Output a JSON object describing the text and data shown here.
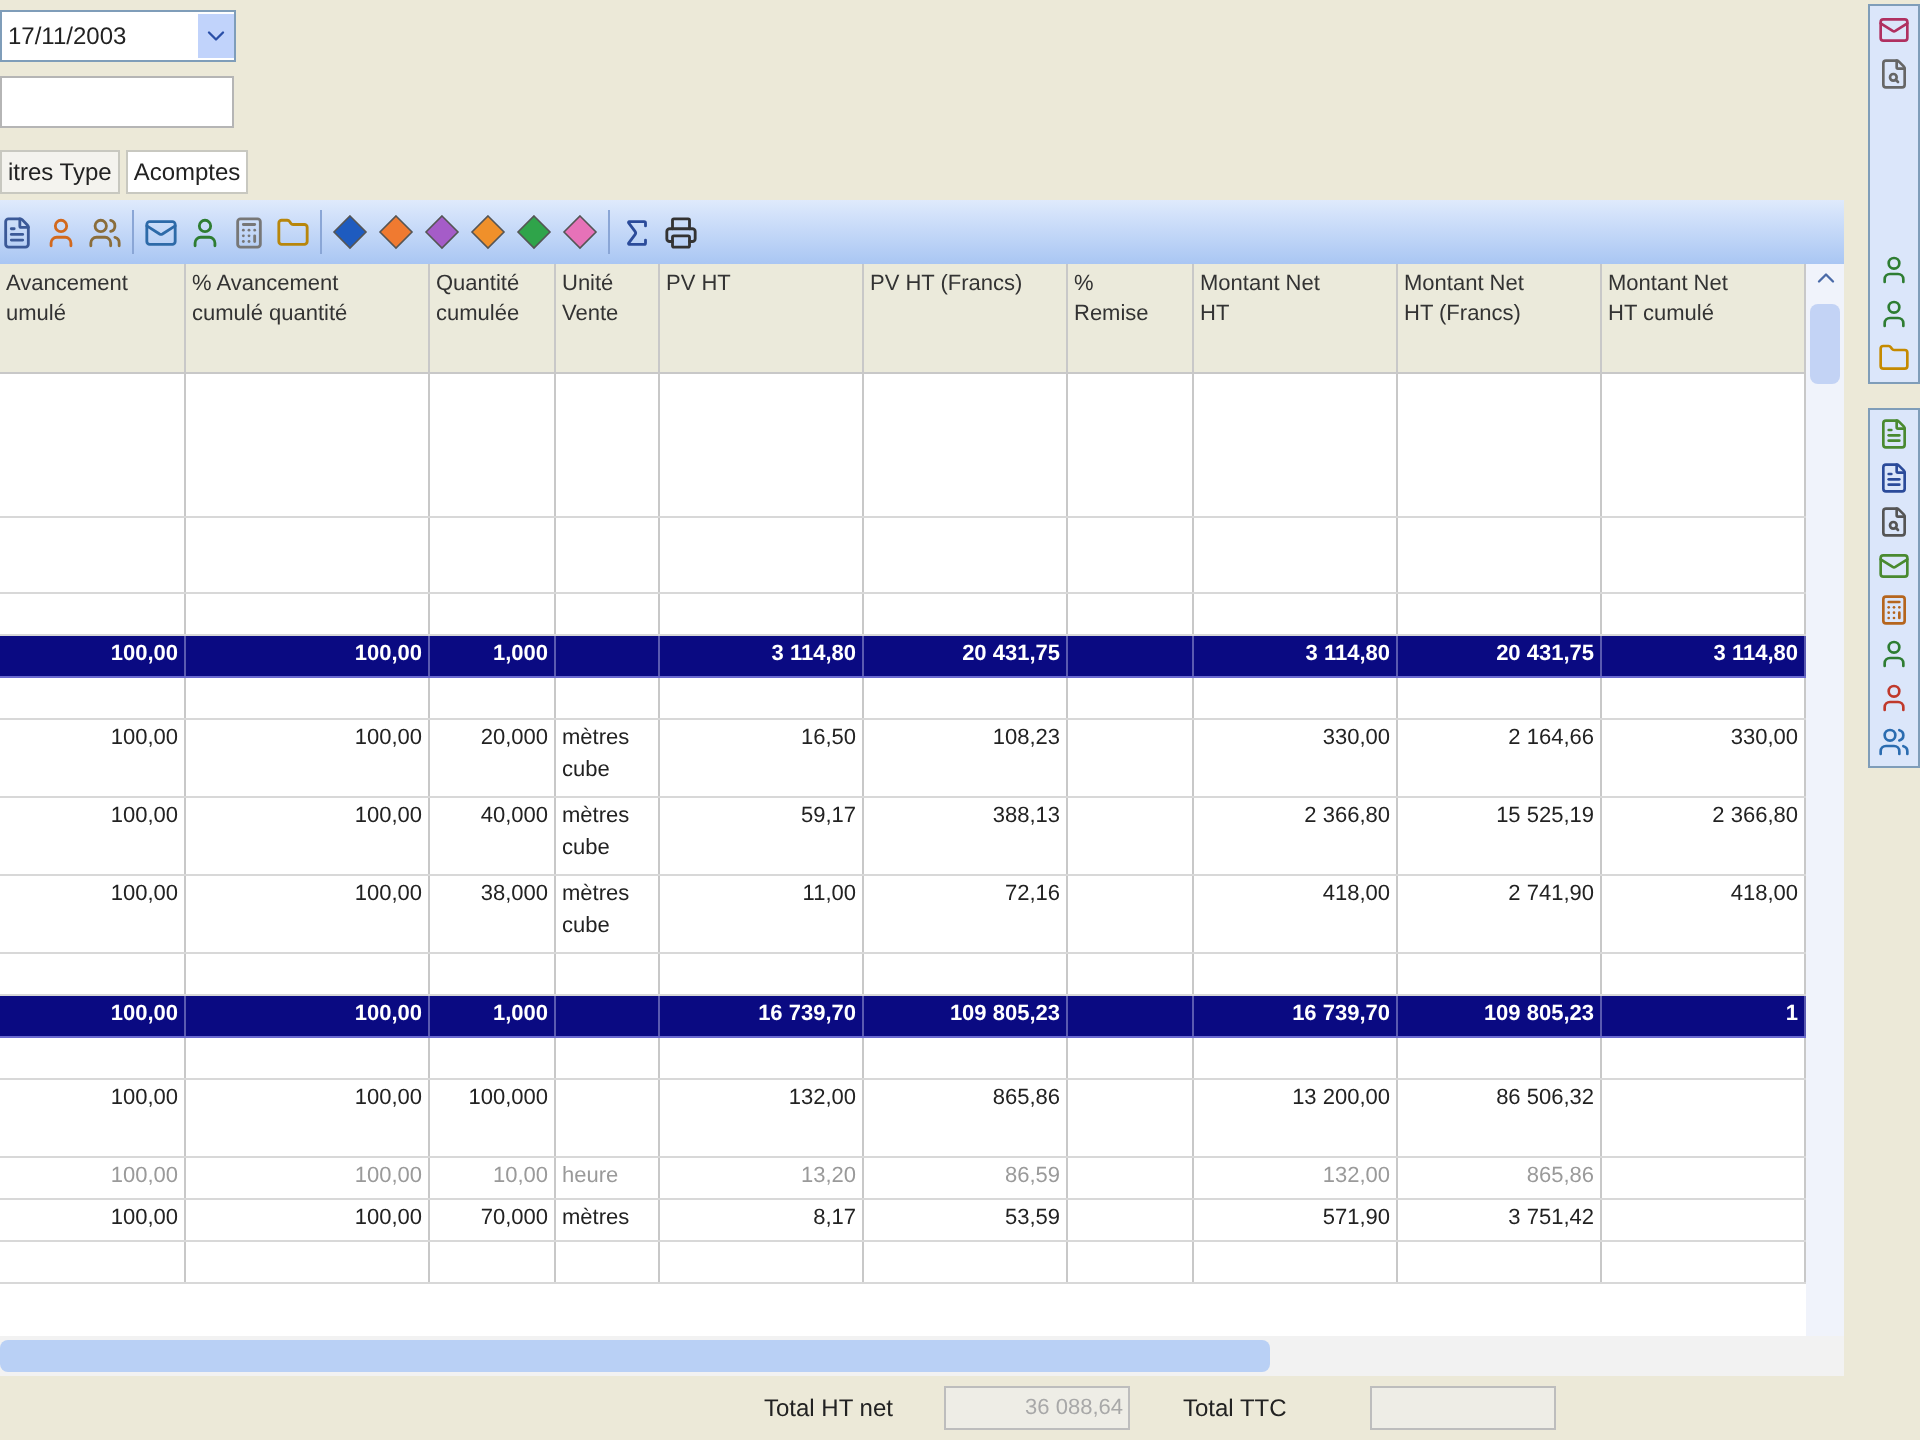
{
  "header_form": {
    "date_value": "17/11/2003"
  },
  "tabs": [
    {
      "label": "itres Type",
      "selected": false
    },
    {
      "label": "Acomptes",
      "selected": true
    }
  ],
  "table": {
    "columns": [
      "Avancement\numulé",
      "% Avancement\ncumulé quantité",
      "Quantité\ncumulée",
      "Unité\nVente",
      "PV HT",
      "PV HT (Francs)",
      "%\nRemise",
      "Montant Net\nHT",
      "Montant Net\nHT (Francs)",
      "Montant Net\nHT cumulé"
    ],
    "rows": [
      {
        "kind": "tall_blank"
      },
      {
        "kind": "medium_blank"
      },
      {
        "kind": "blank"
      },
      {
        "kind": "group",
        "cells": [
          "100,00",
          "100,00",
          "1,000",
          null,
          "3 114,80",
          "20 431,75",
          null,
          "3 114,80",
          "20 431,75",
          "3 114,80"
        ]
      },
      {
        "kind": "blank"
      },
      {
        "kind": "line",
        "disabled": false,
        "cells": [
          "100,00",
          "100,00",
          "20,000",
          "mètres cube",
          "16,50",
          "108,23",
          null,
          "330,00",
          "2 164,66",
          "330,00"
        ]
      },
      {
        "kind": "line",
        "disabled": false,
        "cells": [
          "100,00",
          "100,00",
          "40,000",
          "mètres cube",
          "59,17",
          "388,13",
          null,
          "2 366,80",
          "15 525,19",
          "2 366,80"
        ]
      },
      {
        "kind": "line",
        "disabled": false,
        "cells": [
          "100,00",
          "100,00",
          "38,000",
          "mètres cube",
          "11,00",
          "72,16",
          null,
          "418,00",
          "2 741,90",
          "418,00"
        ]
      },
      {
        "kind": "blank"
      },
      {
        "kind": "group",
        "cells": [
          "100,00",
          "100,00",
          "1,000",
          null,
          "16 739,70",
          "109 805,23",
          null,
          "16 739,70",
          "109 805,23",
          "1"
        ]
      },
      {
        "kind": "blank"
      },
      {
        "kind": "line",
        "disabled": false,
        "cells": [
          "100,00",
          "100,00",
          "100,000",
          null,
          "132,00",
          "865,86",
          null,
          "13 200,00",
          "86 506,32",
          null
        ]
      },
      {
        "kind": "short_line",
        "disabled": true,
        "cells": [
          "100,00",
          "100,00",
          "10,00",
          "heure",
          "13,20",
          "86,59",
          null,
          "132,00",
          "865,86",
          null
        ]
      },
      {
        "kind": "short_line",
        "disabled": false,
        "cells": [
          "100,00",
          "100,00",
          "70,000",
          "mètres",
          "8,17",
          "53,59",
          null,
          "571,90",
          "3 751,42",
          null
        ]
      },
      {
        "kind": "blank"
      }
    ]
  },
  "totals": [
    {
      "label": "Total HT net",
      "value": "36 088,64"
    },
    {
      "label": "Total TTC"
    }
  ]
}
